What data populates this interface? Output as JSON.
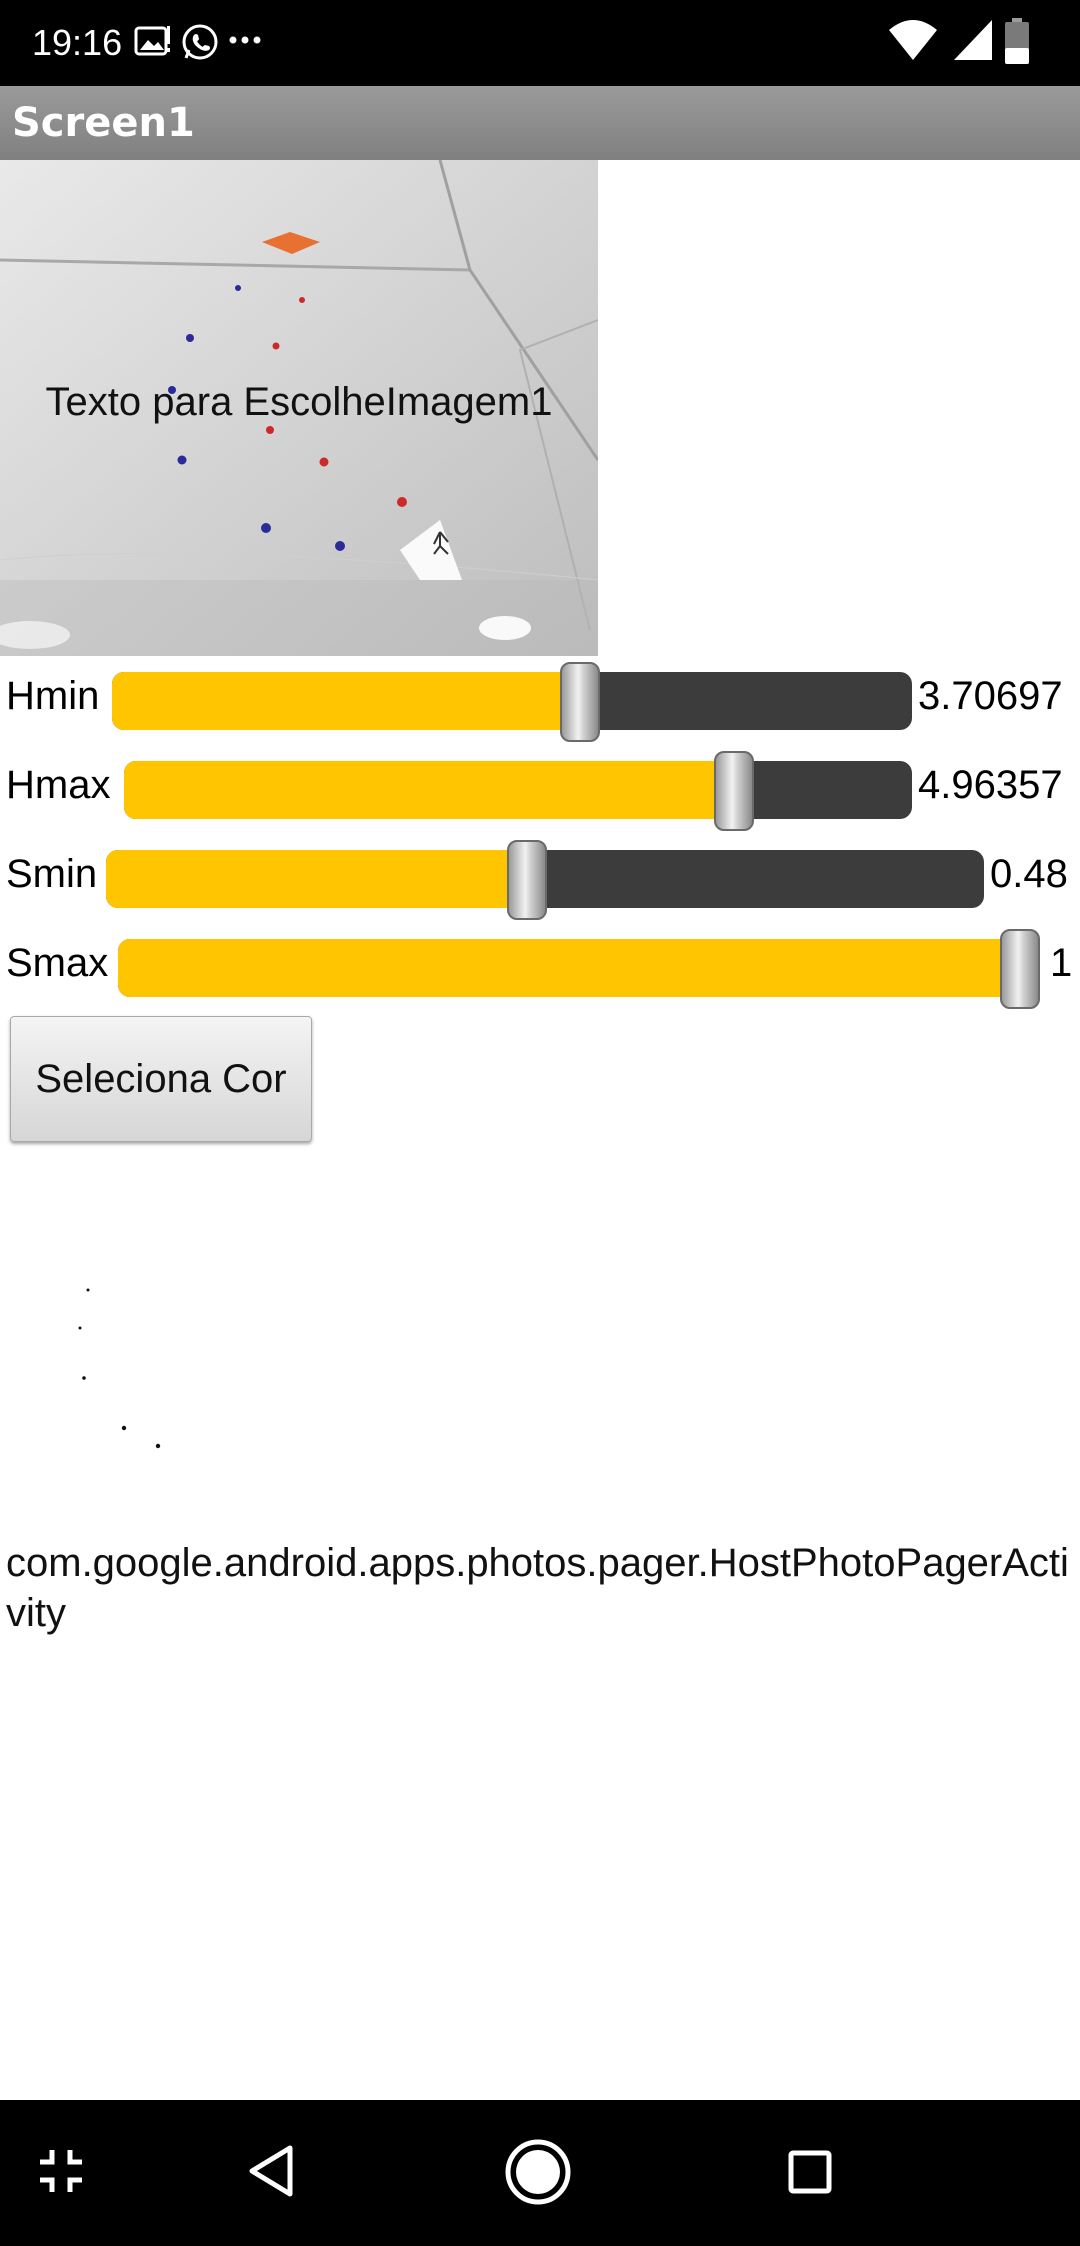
{
  "status_bar": {
    "time": "19:16",
    "icons": [
      "gallery-notification-icon",
      "whatsapp-icon",
      "more-notifications-icon",
      "wifi-icon",
      "signal-icon",
      "battery-icon"
    ]
  },
  "app": {
    "title": "Screen1"
  },
  "image_picker": {
    "caption": "Texto para EscolheImagem1"
  },
  "sliders": [
    {
      "label": "Hmin",
      "value_text": "3.70697",
      "position_fraction": 0.585
    },
    {
      "label": "Hmax",
      "value_text": "4.96357",
      "position_fraction": 0.774
    },
    {
      "label": "Smin",
      "value_text": "0.48",
      "position_fraction": 0.48
    },
    {
      "label": "Smax",
      "value_text": "1",
      "position_fraction": 1.0
    }
  ],
  "button": {
    "label": "Seleciona Cor"
  },
  "info_text": "com.google.android.apps.photos.pager.HostPhotoPagerActivity",
  "colors": {
    "accent": "#ffc600",
    "track": "#3c3c3c",
    "title_bar": "#8c8c8c"
  },
  "nav_bar": {
    "icons": [
      "fullscreen-exit-icon",
      "back-icon",
      "home-icon",
      "recents-icon"
    ]
  }
}
